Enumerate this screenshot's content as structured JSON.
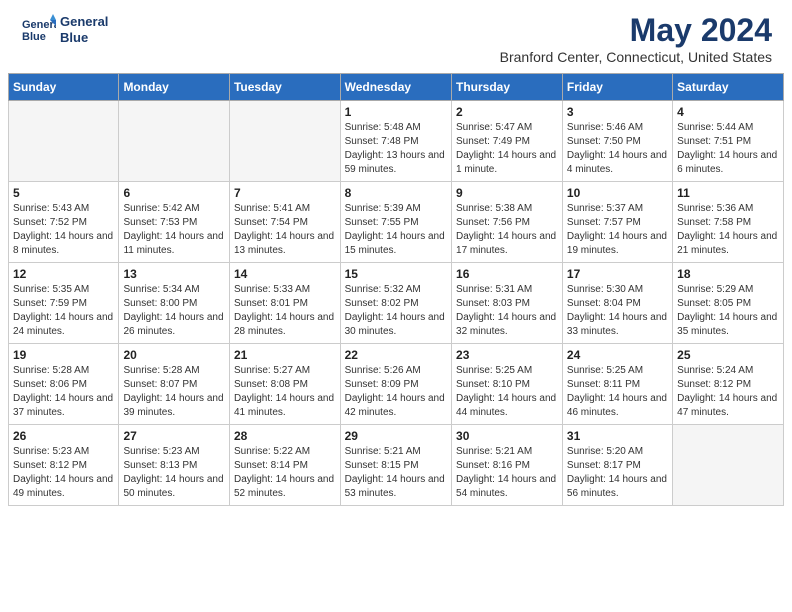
{
  "header": {
    "logo_line1": "General",
    "logo_line2": "Blue",
    "month": "May 2024",
    "location": "Branford Center, Connecticut, United States"
  },
  "days_of_week": [
    "Sunday",
    "Monday",
    "Tuesday",
    "Wednesday",
    "Thursday",
    "Friday",
    "Saturday"
  ],
  "weeks": [
    [
      {
        "day": "",
        "sunrise": "",
        "sunset": "",
        "daylight": ""
      },
      {
        "day": "",
        "sunrise": "",
        "sunset": "",
        "daylight": ""
      },
      {
        "day": "",
        "sunrise": "",
        "sunset": "",
        "daylight": ""
      },
      {
        "day": "1",
        "sunrise": "Sunrise: 5:48 AM",
        "sunset": "Sunset: 7:48 PM",
        "daylight": "Daylight: 13 hours and 59 minutes."
      },
      {
        "day": "2",
        "sunrise": "Sunrise: 5:47 AM",
        "sunset": "Sunset: 7:49 PM",
        "daylight": "Daylight: 14 hours and 1 minute."
      },
      {
        "day": "3",
        "sunrise": "Sunrise: 5:46 AM",
        "sunset": "Sunset: 7:50 PM",
        "daylight": "Daylight: 14 hours and 4 minutes."
      },
      {
        "day": "4",
        "sunrise": "Sunrise: 5:44 AM",
        "sunset": "Sunset: 7:51 PM",
        "daylight": "Daylight: 14 hours and 6 minutes."
      }
    ],
    [
      {
        "day": "5",
        "sunrise": "Sunrise: 5:43 AM",
        "sunset": "Sunset: 7:52 PM",
        "daylight": "Daylight: 14 hours and 8 minutes."
      },
      {
        "day": "6",
        "sunrise": "Sunrise: 5:42 AM",
        "sunset": "Sunset: 7:53 PM",
        "daylight": "Daylight: 14 hours and 11 minutes."
      },
      {
        "day": "7",
        "sunrise": "Sunrise: 5:41 AM",
        "sunset": "Sunset: 7:54 PM",
        "daylight": "Daylight: 14 hours and 13 minutes."
      },
      {
        "day": "8",
        "sunrise": "Sunrise: 5:39 AM",
        "sunset": "Sunset: 7:55 PM",
        "daylight": "Daylight: 14 hours and 15 minutes."
      },
      {
        "day": "9",
        "sunrise": "Sunrise: 5:38 AM",
        "sunset": "Sunset: 7:56 PM",
        "daylight": "Daylight: 14 hours and 17 minutes."
      },
      {
        "day": "10",
        "sunrise": "Sunrise: 5:37 AM",
        "sunset": "Sunset: 7:57 PM",
        "daylight": "Daylight: 14 hours and 19 minutes."
      },
      {
        "day": "11",
        "sunrise": "Sunrise: 5:36 AM",
        "sunset": "Sunset: 7:58 PM",
        "daylight": "Daylight: 14 hours and 21 minutes."
      }
    ],
    [
      {
        "day": "12",
        "sunrise": "Sunrise: 5:35 AM",
        "sunset": "Sunset: 7:59 PM",
        "daylight": "Daylight: 14 hours and 24 minutes."
      },
      {
        "day": "13",
        "sunrise": "Sunrise: 5:34 AM",
        "sunset": "Sunset: 8:00 PM",
        "daylight": "Daylight: 14 hours and 26 minutes."
      },
      {
        "day": "14",
        "sunrise": "Sunrise: 5:33 AM",
        "sunset": "Sunset: 8:01 PM",
        "daylight": "Daylight: 14 hours and 28 minutes."
      },
      {
        "day": "15",
        "sunrise": "Sunrise: 5:32 AM",
        "sunset": "Sunset: 8:02 PM",
        "daylight": "Daylight: 14 hours and 30 minutes."
      },
      {
        "day": "16",
        "sunrise": "Sunrise: 5:31 AM",
        "sunset": "Sunset: 8:03 PM",
        "daylight": "Daylight: 14 hours and 32 minutes."
      },
      {
        "day": "17",
        "sunrise": "Sunrise: 5:30 AM",
        "sunset": "Sunset: 8:04 PM",
        "daylight": "Daylight: 14 hours and 33 minutes."
      },
      {
        "day": "18",
        "sunrise": "Sunrise: 5:29 AM",
        "sunset": "Sunset: 8:05 PM",
        "daylight": "Daylight: 14 hours and 35 minutes."
      }
    ],
    [
      {
        "day": "19",
        "sunrise": "Sunrise: 5:28 AM",
        "sunset": "Sunset: 8:06 PM",
        "daylight": "Daylight: 14 hours and 37 minutes."
      },
      {
        "day": "20",
        "sunrise": "Sunrise: 5:28 AM",
        "sunset": "Sunset: 8:07 PM",
        "daylight": "Daylight: 14 hours and 39 minutes."
      },
      {
        "day": "21",
        "sunrise": "Sunrise: 5:27 AM",
        "sunset": "Sunset: 8:08 PM",
        "daylight": "Daylight: 14 hours and 41 minutes."
      },
      {
        "day": "22",
        "sunrise": "Sunrise: 5:26 AM",
        "sunset": "Sunset: 8:09 PM",
        "daylight": "Daylight: 14 hours and 42 minutes."
      },
      {
        "day": "23",
        "sunrise": "Sunrise: 5:25 AM",
        "sunset": "Sunset: 8:10 PM",
        "daylight": "Daylight: 14 hours and 44 minutes."
      },
      {
        "day": "24",
        "sunrise": "Sunrise: 5:25 AM",
        "sunset": "Sunset: 8:11 PM",
        "daylight": "Daylight: 14 hours and 46 minutes."
      },
      {
        "day": "25",
        "sunrise": "Sunrise: 5:24 AM",
        "sunset": "Sunset: 8:12 PM",
        "daylight": "Daylight: 14 hours and 47 minutes."
      }
    ],
    [
      {
        "day": "26",
        "sunrise": "Sunrise: 5:23 AM",
        "sunset": "Sunset: 8:12 PM",
        "daylight": "Daylight: 14 hours and 49 minutes."
      },
      {
        "day": "27",
        "sunrise": "Sunrise: 5:23 AM",
        "sunset": "Sunset: 8:13 PM",
        "daylight": "Daylight: 14 hours and 50 minutes."
      },
      {
        "day": "28",
        "sunrise": "Sunrise: 5:22 AM",
        "sunset": "Sunset: 8:14 PM",
        "daylight": "Daylight: 14 hours and 52 minutes."
      },
      {
        "day": "29",
        "sunrise": "Sunrise: 5:21 AM",
        "sunset": "Sunset: 8:15 PM",
        "daylight": "Daylight: 14 hours and 53 minutes."
      },
      {
        "day": "30",
        "sunrise": "Sunrise: 5:21 AM",
        "sunset": "Sunset: 8:16 PM",
        "daylight": "Daylight: 14 hours and 54 minutes."
      },
      {
        "day": "31",
        "sunrise": "Sunrise: 5:20 AM",
        "sunset": "Sunset: 8:17 PM",
        "daylight": "Daylight: 14 hours and 56 minutes."
      },
      {
        "day": "",
        "sunrise": "",
        "sunset": "",
        "daylight": ""
      }
    ]
  ]
}
